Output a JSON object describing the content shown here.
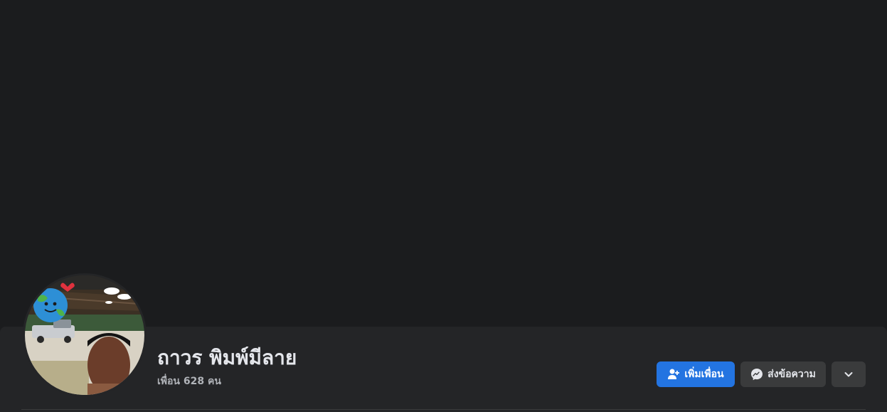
{
  "profile": {
    "name": "ถาวร พิมพ์มีลาย",
    "friends_text": "เพื่อน 628 คน"
  },
  "actions": {
    "add_friend_label": "เพิ่มเพื่อน",
    "message_label": "ส่งข้อความ",
    "more_icon": "chevron-down-icon"
  },
  "colors": {
    "background": "#1b1c1e",
    "header_band": "#242527",
    "primary_button": "#2374e1",
    "secondary_button": "#3a3b3c",
    "text_primary": "#e4e6eb",
    "text_secondary": "#b0b3b8"
  }
}
